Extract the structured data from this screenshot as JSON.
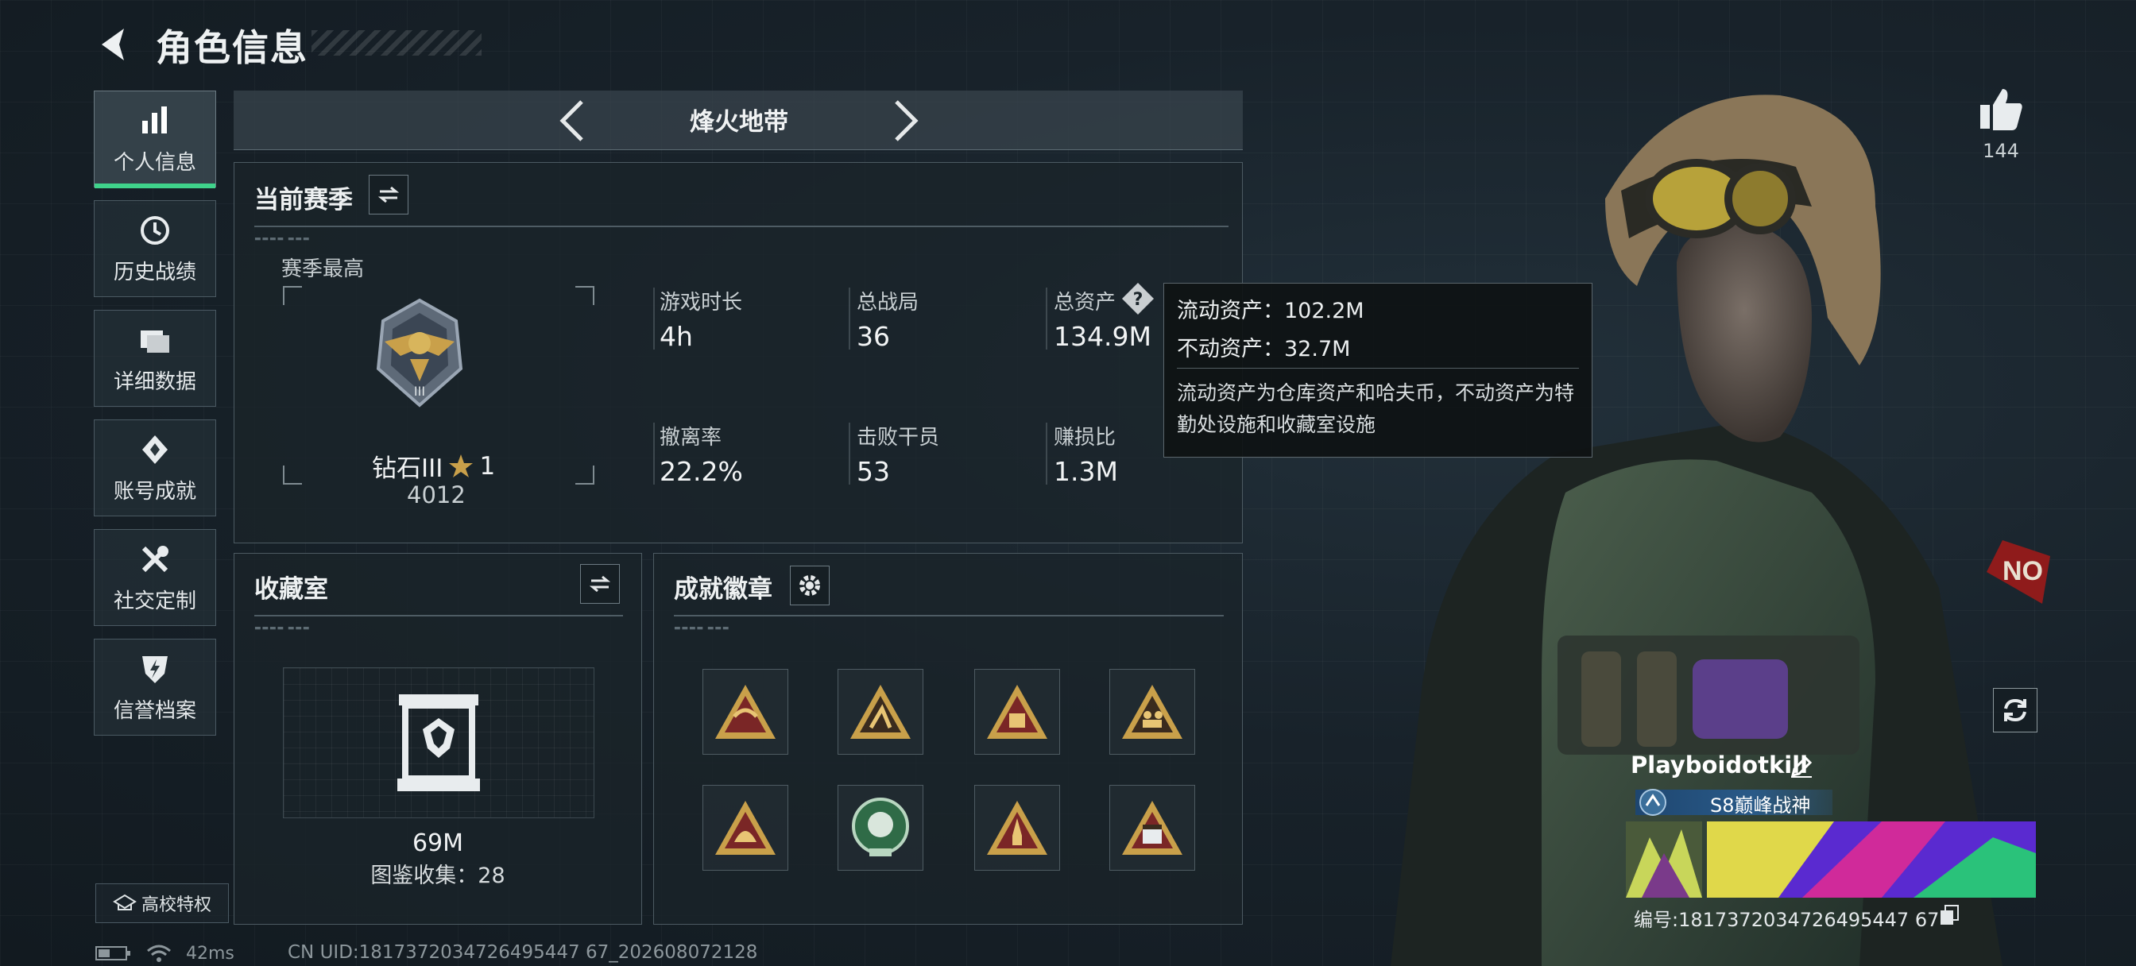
{
  "header": {
    "title": "角色信息"
  },
  "sidebar": {
    "items": [
      {
        "label": "个人信息",
        "icon": "bar-chart-icon",
        "active": true
      },
      {
        "label": "历史战绩",
        "icon": "history-icon",
        "active": false
      },
      {
        "label": "详细数据",
        "icon": "folders-icon",
        "active": false
      },
      {
        "label": "账号成就",
        "icon": "achievement-icon",
        "active": false
      },
      {
        "label": "社交定制",
        "icon": "wrench-icon",
        "active": false
      },
      {
        "label": "信誉档案",
        "icon": "shield-icon",
        "active": false
      }
    ],
    "school_button": "高校特权"
  },
  "status": {
    "ping": "42ms",
    "uid": "CN UID:1817372034726495447 67_202608072128"
  },
  "mode": {
    "name": "烽火地带"
  },
  "season": {
    "title": "当前赛季",
    "best_label": "赛季最高",
    "rank_name": "钻石III",
    "rank_stars": "1",
    "rank_points": "4012",
    "stats": {
      "play_time_label": "游戏时长",
      "play_time": "4h",
      "matches_label": "总战局",
      "matches": "36",
      "assets_label": "总资产",
      "assets": "134.9M",
      "extract_label": "撤离率",
      "extract": "22.2%",
      "kills_label": "击败干员",
      "kills": "53",
      "ratio_label": "赚损比",
      "ratio": "1.3M"
    }
  },
  "tooltip": {
    "liquid": "流动资产：102.2M",
    "fixed": "不动资产：32.7M",
    "desc": "流动资产为仓库资产和哈夫币，不动资产为特勤处设施和收藏室设施"
  },
  "collection": {
    "title": "收藏室",
    "value": "69M",
    "catalog": "图鉴收集：28"
  },
  "badges": {
    "title": "成就徽章",
    "items": [
      "paratrooper-badge-icon",
      "climber-badge-icon",
      "package-badge-icon",
      "soldiers-badge-icon",
      "helmet-badge-icon",
      "planet-badge-icon",
      "rocket-badge-icon",
      "calendar-badge-icon"
    ]
  },
  "player": {
    "likes": "144",
    "name": "Playboidotkill",
    "rank_title": "S8巅峰战神",
    "player_id": "编号:1817372034726495447 67"
  },
  "colors": {
    "accent": "#3fd38b",
    "gold": "#c9a04a",
    "panel": "#1a242a",
    "title_blue": "#2a5a88"
  }
}
